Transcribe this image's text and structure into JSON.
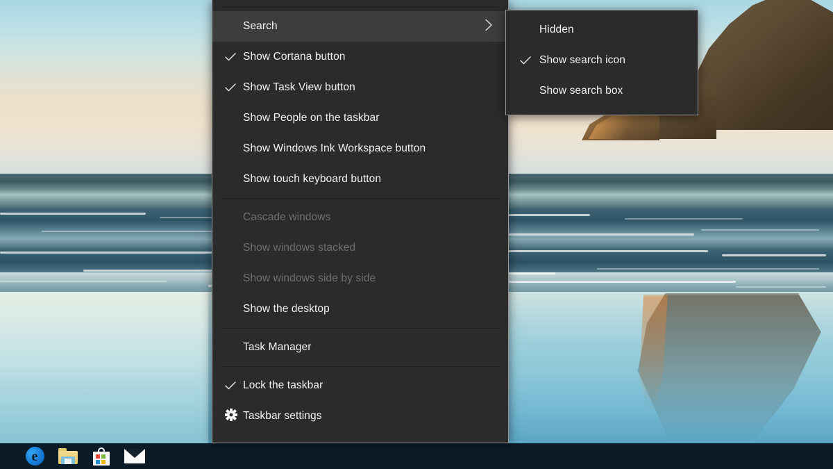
{
  "desktop": {
    "wallpaper_name": "wharariki-beach-wallpaper",
    "sky_color": "#cfe4e0",
    "ocean_color": "#3e6475",
    "sand_color": "#8ec7d8",
    "rock_color": "#5c4a33"
  },
  "context_menu": {
    "background": "#2b2b2b",
    "text_color": "#f2f2f2",
    "disabled_color": "#6f6f6f",
    "highlight_color": "#3d3d3d",
    "sections": [
      {
        "items": [
          {
            "label": "Search",
            "checked": false,
            "disabled": false,
            "highlighted": true,
            "submenu": true,
            "icon": "chevron-right-icon"
          },
          {
            "label": "Show Cortana button",
            "checked": true,
            "disabled": false,
            "highlighted": false,
            "submenu": false,
            "icon": "check-icon"
          },
          {
            "label": "Show Task View button",
            "checked": true,
            "disabled": false,
            "highlighted": false,
            "submenu": false,
            "icon": "check-icon"
          },
          {
            "label": "Show People on the taskbar",
            "checked": false,
            "disabled": false,
            "highlighted": false,
            "submenu": false,
            "icon": ""
          },
          {
            "label": "Show Windows Ink Workspace button",
            "checked": false,
            "disabled": false,
            "highlighted": false,
            "submenu": false,
            "icon": ""
          },
          {
            "label": "Show touch keyboard button",
            "checked": false,
            "disabled": false,
            "highlighted": false,
            "submenu": false,
            "icon": ""
          }
        ]
      },
      {
        "items": [
          {
            "label": "Cascade windows",
            "checked": false,
            "disabled": true,
            "highlighted": false,
            "submenu": false,
            "icon": ""
          },
          {
            "label": "Show windows stacked",
            "checked": false,
            "disabled": true,
            "highlighted": false,
            "submenu": false,
            "icon": ""
          },
          {
            "label": "Show windows side by side",
            "checked": false,
            "disabled": true,
            "highlighted": false,
            "submenu": false,
            "icon": ""
          },
          {
            "label": "Show the desktop",
            "checked": false,
            "disabled": false,
            "highlighted": false,
            "submenu": false,
            "icon": ""
          }
        ]
      },
      {
        "items": [
          {
            "label": "Task Manager",
            "checked": false,
            "disabled": false,
            "highlighted": false,
            "submenu": false,
            "icon": ""
          }
        ]
      },
      {
        "items": [
          {
            "label": "Lock the taskbar",
            "checked": true,
            "disabled": false,
            "highlighted": false,
            "submenu": false,
            "icon": "check-icon"
          },
          {
            "label": "Taskbar settings",
            "checked": false,
            "disabled": false,
            "highlighted": false,
            "submenu": false,
            "icon": "gear-icon"
          }
        ]
      }
    ]
  },
  "submenu": {
    "parent": "Search",
    "items": [
      {
        "label": "Hidden",
        "checked": false,
        "icon": ""
      },
      {
        "label": "Show search icon",
        "checked": true,
        "icon": "check-icon"
      },
      {
        "label": "Show search box",
        "checked": false,
        "icon": ""
      }
    ]
  },
  "taskbar": {
    "background": "#0b1c28",
    "items": [
      {
        "name": "microsoft-edge",
        "label": "e"
      },
      {
        "name": "file-explorer",
        "label": ""
      },
      {
        "name": "microsoft-store",
        "label": ""
      },
      {
        "name": "mail",
        "label": ""
      }
    ],
    "store_square_colors": [
      "#e8493a",
      "#7bb93b",
      "#2a8fd4",
      "#f5b617"
    ]
  }
}
